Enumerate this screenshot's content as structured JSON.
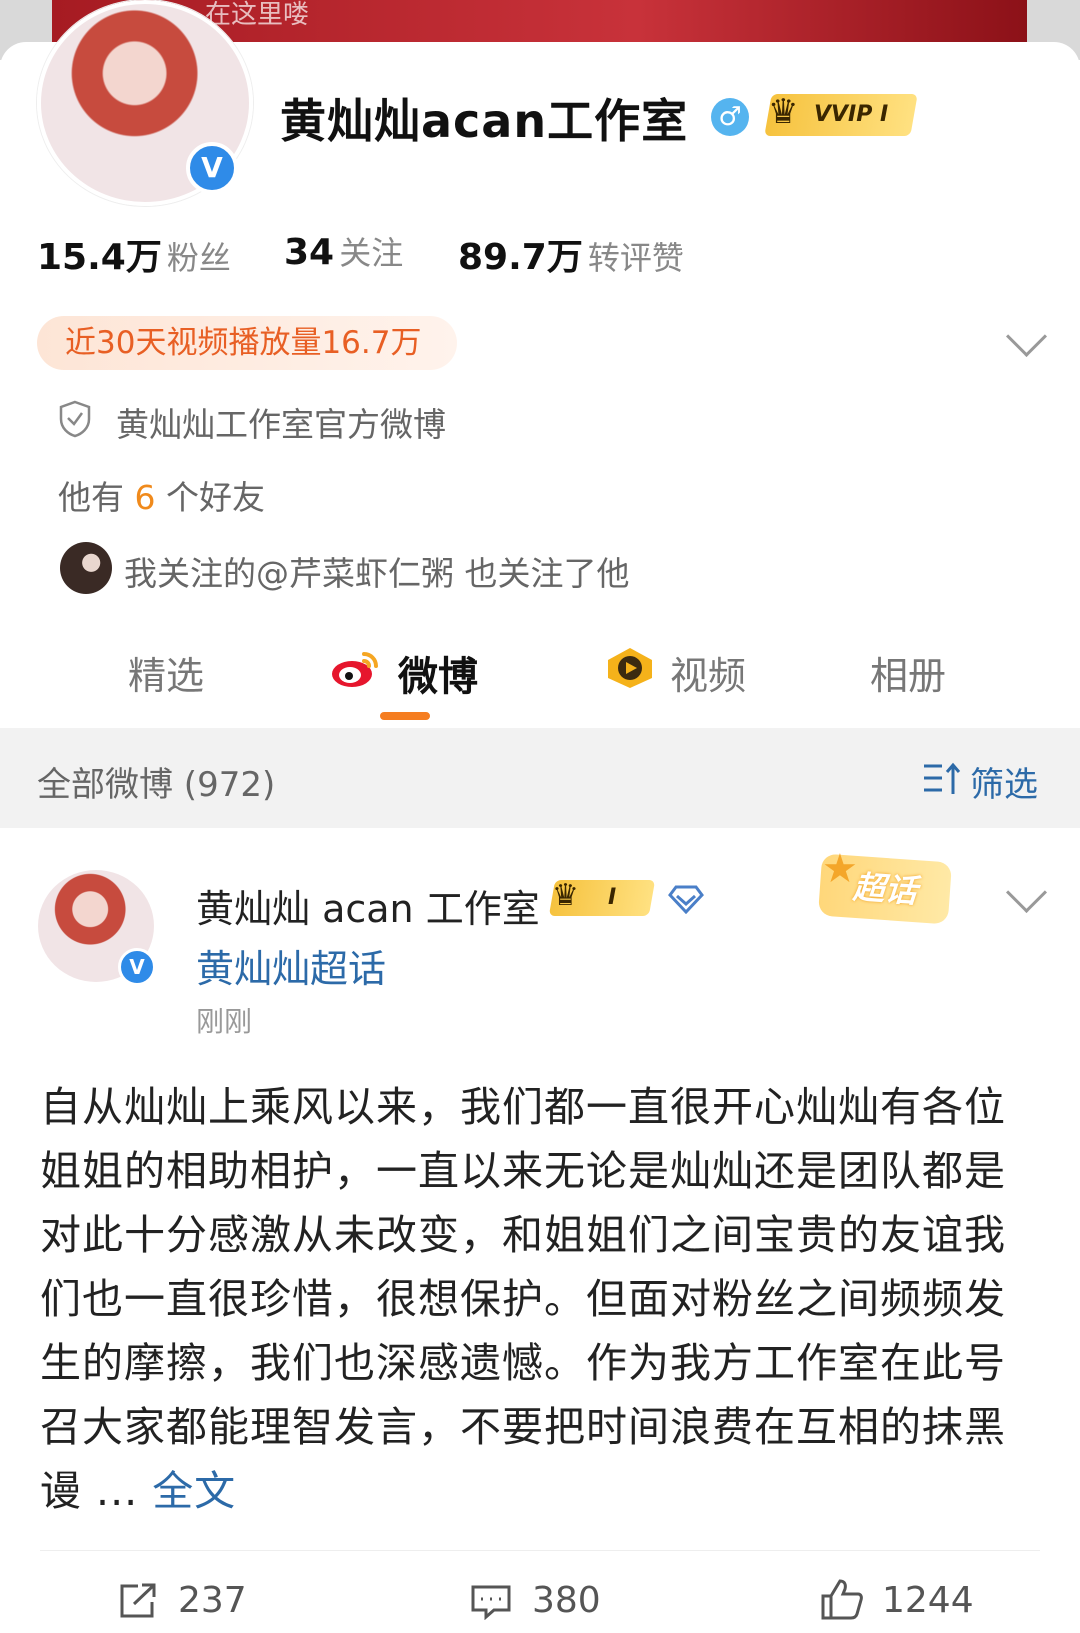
{
  "banner": {
    "text": "在这里喽"
  },
  "profile": {
    "name": "黄灿灿acan工作室",
    "gender_symbol": "♂",
    "vip_label": "VVIP I",
    "stats": [
      {
        "value": "15.4万",
        "label": "粉丝"
      },
      {
        "value": "34",
        "label": "关注"
      },
      {
        "value": "89.7万",
        "label": "转评赞"
      }
    ],
    "video_pill": "近30天视频播放量16.7万",
    "verified_desc": "黄灿灿工作室官方微博",
    "friends_prefix": "他有",
    "friends_count": "6",
    "friends_suffix": "个好友",
    "mutual_follow": "我关注的@芹菜虾仁粥 也关注了他"
  },
  "tabs": [
    {
      "label": "精选"
    },
    {
      "label": "微博"
    },
    {
      "label": "视频"
    },
    {
      "label": "相册"
    }
  ],
  "filter_bar": {
    "title": "全部微博 (972)",
    "filter_label": "筛选"
  },
  "post": {
    "author": "黄灿灿 acan 工作室",
    "member_badge": "I",
    "supertopic": "黄灿灿超话",
    "time": "刚刚",
    "supertopic_badge": "超话",
    "body": "自从灿灿上乘风以来，我们都一直很开心灿灿有各位姐姐的相助相护，一直以来无论是灿灿还是团队都是对此十分感激从未改变，和姐姐们之间宝贵的友谊我们也一直很珍惜，很想保护。但面对粉丝之间频频发生的摩擦，我们也深感遗憾。作为我方工作室在此号召大家都能理智发言，不要把时间浪费在互相的抹黑谩 ...",
    "read_more": "全文",
    "repost_count": "237",
    "comment_count": "380",
    "like_count": "1244"
  },
  "colors": {
    "accent": "#f57d20",
    "link": "#2c6aa8",
    "verified": "#2f8be8"
  }
}
